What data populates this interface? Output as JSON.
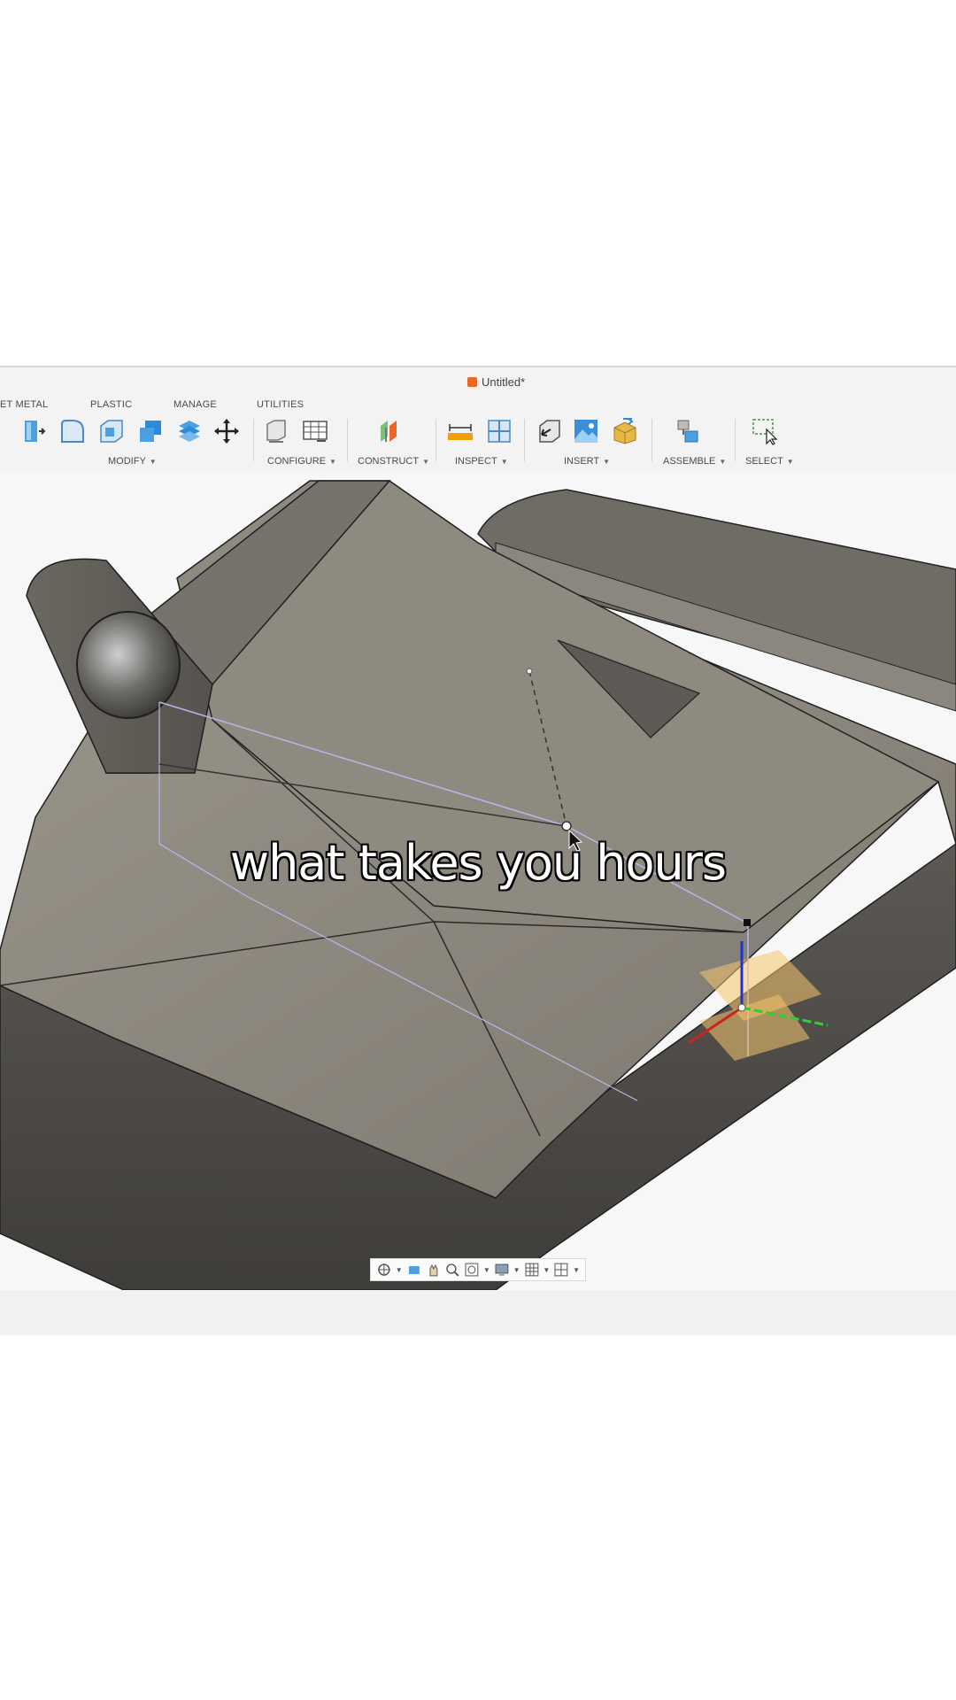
{
  "window": {
    "title": "Untitled*"
  },
  "tabs": [
    "ET METAL",
    "PLASTIC",
    "MANAGE",
    "UTILITIES"
  ],
  "toolbar": {
    "groups": [
      {
        "label": "MODIFY",
        "icons": [
          "press-pull-icon",
          "fillet-icon",
          "shell-icon",
          "combine-icon",
          "replace-face-icon",
          "move-icon"
        ]
      },
      {
        "label": "CONFIGURE",
        "icons": [
          "configure-icon",
          "table-icon"
        ]
      },
      {
        "label": "CONSTRUCT",
        "icons": [
          "plane-icon"
        ]
      },
      {
        "label": "INSPECT",
        "icons": [
          "measure-icon",
          "section-analysis-icon"
        ]
      },
      {
        "label": "INSERT",
        "icons": [
          "insert-derive-icon",
          "canvas-image-icon",
          "insert-mesh-icon"
        ]
      },
      {
        "label": "ASSEMBLE",
        "icons": [
          "joint-icon"
        ]
      },
      {
        "label": "SELECT",
        "icons": [
          "select-icon"
        ]
      }
    ]
  },
  "caption": "what takes you hours",
  "navbar": {
    "icons": [
      "orbit-icon",
      "look-at-icon",
      "pan-icon",
      "zoom-icon",
      "fit-icon",
      "display-settings-icon",
      "grid-icon",
      "viewports-icon"
    ]
  },
  "colors": {
    "accent": "#2e8bd8",
    "model": "#8a857c",
    "model_dark": "#5d5a55",
    "orange": "#e8682a"
  }
}
